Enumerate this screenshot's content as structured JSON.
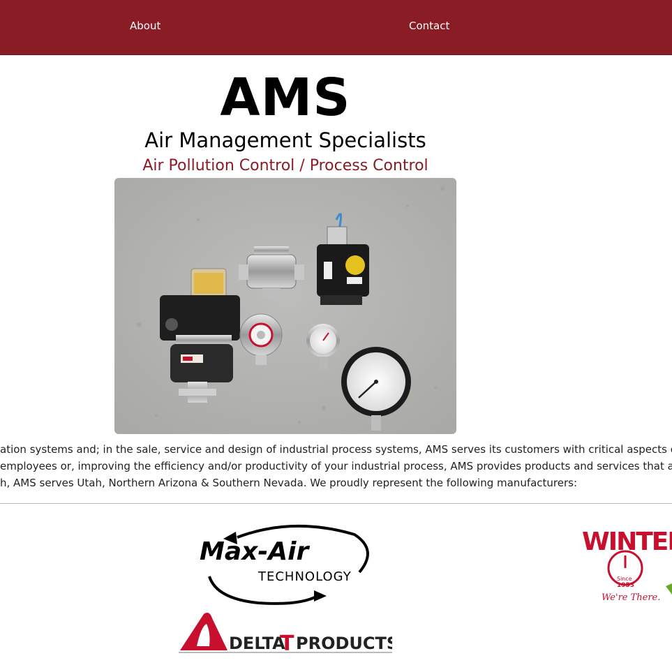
{
  "nav": {
    "about": "About",
    "contact": "Contact"
  },
  "brand": {
    "title": "AMS",
    "subtitle": "Air Management Specialists",
    "tagline": "Air Pollution Control / Process Control"
  },
  "hero": {
    "caption": "Industrial valves, actuators and pressure gauges"
  },
  "intro": {
    "lines": [
      "ation systems and; in the sale, service and design of industrial process systems, AMS serves its customers with critical aspects of their",
      "employees or, improving the efficiency and/or productivity of your industrial process, AMS provides products and services that add val",
      "h, AMS serves Utah, Northern Arizona & Southern Nevada. We proudly represent the following manufacturers:"
    ]
  },
  "manufacturers": {
    "maxair": {
      "name": "Max-Air",
      "sub": "TECHNOLOGY"
    },
    "deltat": {
      "part1": "DELTA",
      "part2": "T",
      "part3": "PRODUCTS"
    },
    "winters": {
      "name": "WINTERS",
      "since": "Since",
      "year": "1953",
      "slogan": "We're There."
    }
  },
  "colors": {
    "brand_red": "#8a1c26",
    "logo_red": "#c8102e",
    "green": "#6aa52c"
  }
}
